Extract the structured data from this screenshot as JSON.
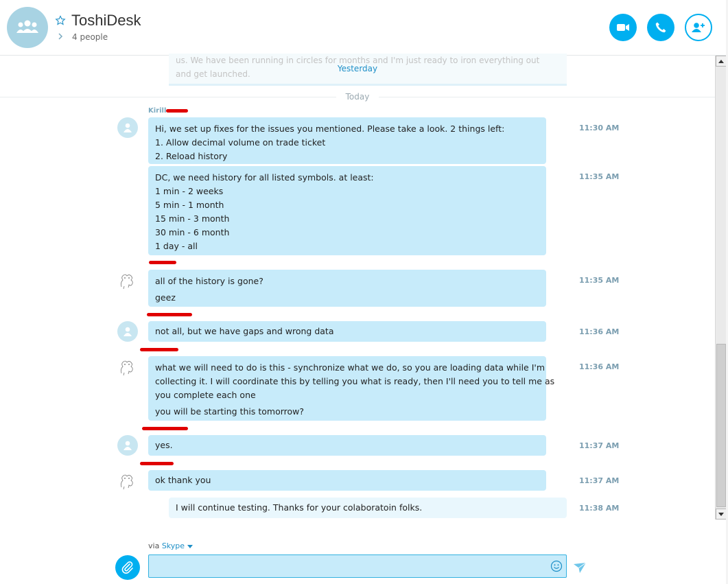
{
  "header": {
    "title": "ToshiDesk",
    "subtitle": "4 people"
  },
  "history": {
    "faded_text": "us. We have been running in circles for months and I'm just ready to iron everything out and get launched.",
    "yesterday_label": "Yesterday",
    "today_label": "Today"
  },
  "messages": [
    {
      "sender": "Kirill",
      "time": "11:30 AM",
      "lines": [
        "Hi, we set up fixes for the issues you mentioned. Please take a look. 2 things left:",
        "1. Allow decimal volume on trade ticket",
        "2. Reload history"
      ]
    },
    {
      "time": "11:35 AM",
      "lines": [
        "DC, we need history for all listed symbols. at least:",
        "1 min - 2 weeks",
        "5 min - 1 month",
        "15 min - 3 month",
        "30 min - 6 month",
        "1 day - all"
      ]
    },
    {
      "time": "11:35 AM",
      "lines": [
        "all of the history is gone?",
        "geez"
      ]
    },
    {
      "time": "11:36 AM",
      "lines": [
        "not all, but we have gaps and wrong data"
      ]
    },
    {
      "time": "11:36 AM",
      "lines": [
        "what we will need to do is this - synchronize what we do, so you are loading data while I'm",
        "collecting it. I will coordinate this by telling you what is ready, then I'll need you to tell me as",
        "you complete each one",
        "you will be starting this tomorrow?"
      ]
    },
    {
      "time": "11:37 AM",
      "lines": [
        "yes."
      ]
    },
    {
      "time": "11:37 AM",
      "lines": [
        "ok thank you"
      ]
    },
    {
      "time": "11:38 AM",
      "lines": [
        "I will continue testing. Thanks for your colaboratoin folks."
      ]
    }
  ],
  "footer": {
    "via_label": "via",
    "via_service": "Skype",
    "composer_value": "",
    "composer_placeholder": ""
  },
  "colors": {
    "accent": "#00aff0",
    "bubble": "#c7ebfa",
    "own_bubble": "#e9f7fd",
    "redaction": "#e00000"
  },
  "icons": [
    "group-avatar-icon",
    "star-icon",
    "chevron-right-icon",
    "video-call-icon",
    "audio-call-icon",
    "add-people-icon",
    "contact-avatar-icon",
    "attach-icon",
    "emoji-icon",
    "send-icon",
    "scroll-up-icon",
    "scroll-down-icon"
  ]
}
